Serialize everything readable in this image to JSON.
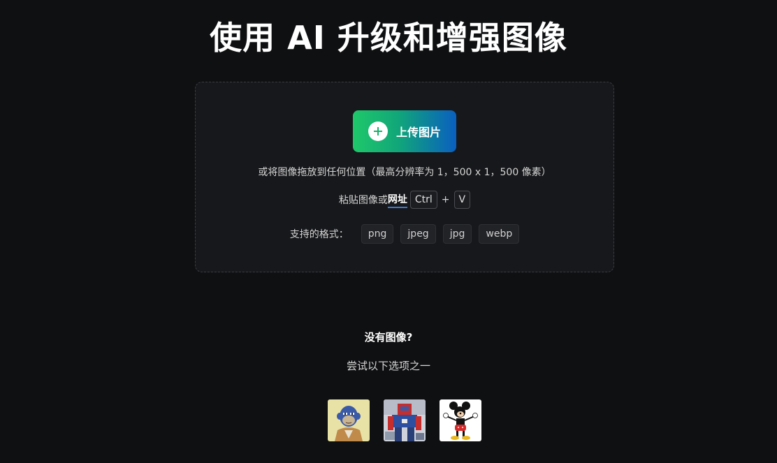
{
  "page": {
    "title": "使用 AI 升级和增强图像"
  },
  "upload": {
    "button_label": "上传图片",
    "button_icon": "plus-icon",
    "drag_hint": "或将图像拖放到任何位置（最高分辨率为 1，500 x 1，500 像素）",
    "paste_prefix": "粘贴图像或",
    "url_link": "网址",
    "key_ctrl": "Ctrl",
    "key_plus": "+",
    "key_v": "V",
    "formats_label": "支持的格式：",
    "formats": [
      "png",
      "jpeg",
      "jpg",
      "webp"
    ]
  },
  "samples_section": {
    "heading": "没有图像?",
    "subheading": "尝试以下选项之一",
    "samples": [
      "ape-cartoon-thumbnail",
      "robot-figure-thumbnail",
      "mickey-mouse-thumbnail"
    ]
  },
  "colors": {
    "background": "#0f1012",
    "dropzone": "#17181b",
    "button_gradient_start": "#1fc86a",
    "button_gradient_end": "#0a5fc0",
    "link_underline": "#3a7bd5"
  }
}
